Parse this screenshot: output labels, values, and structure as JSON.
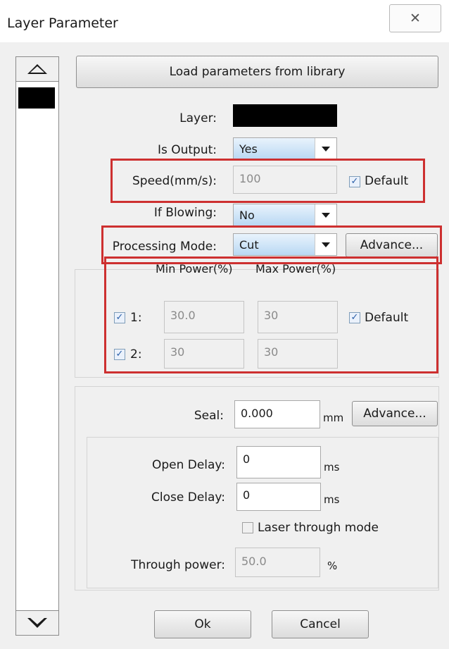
{
  "window": {
    "title": "Layer Parameter",
    "close_glyph": "✕"
  },
  "load_button": "Load parameters from library",
  "layer": {
    "label": "Layer:",
    "color": "#000000"
  },
  "is_output": {
    "label": "Is Output:",
    "value": "Yes"
  },
  "speed": {
    "label": "Speed(mm/s):",
    "value": "100",
    "default_label": "Default",
    "default_checked": true
  },
  "if_blowing": {
    "label": "If Blowing:",
    "value": "No"
  },
  "processing_mode": {
    "label": "Processing Mode:",
    "value": "Cut",
    "advance_label": "Advance..."
  },
  "power": {
    "min_header": "Min Power(%)",
    "max_header": "Max Power(%)",
    "rows": [
      {
        "label": "1:",
        "checked": true,
        "min": "30.0",
        "max": "30"
      },
      {
        "label": "2:",
        "checked": true,
        "min": "30",
        "max": "30"
      }
    ],
    "default_label": "Default",
    "default_checked": true
  },
  "seal": {
    "label": "Seal:",
    "value": "0.000",
    "unit": "mm",
    "advance_label": "Advance..."
  },
  "open_delay": {
    "label": "Open Delay:",
    "value": "0",
    "unit": "ms"
  },
  "close_delay": {
    "label": "Close Delay:",
    "value": "0",
    "unit": "ms"
  },
  "laser_through": {
    "label": "Laser through mode",
    "checked": false
  },
  "through_power": {
    "label": "Through power:",
    "value": "50.0",
    "unit": "%"
  },
  "footer": {
    "ok_label": "Ok",
    "cancel_label": "Cancel"
  },
  "accent": {
    "highlight": "#cd3030",
    "selection": "#b9d8f3"
  }
}
